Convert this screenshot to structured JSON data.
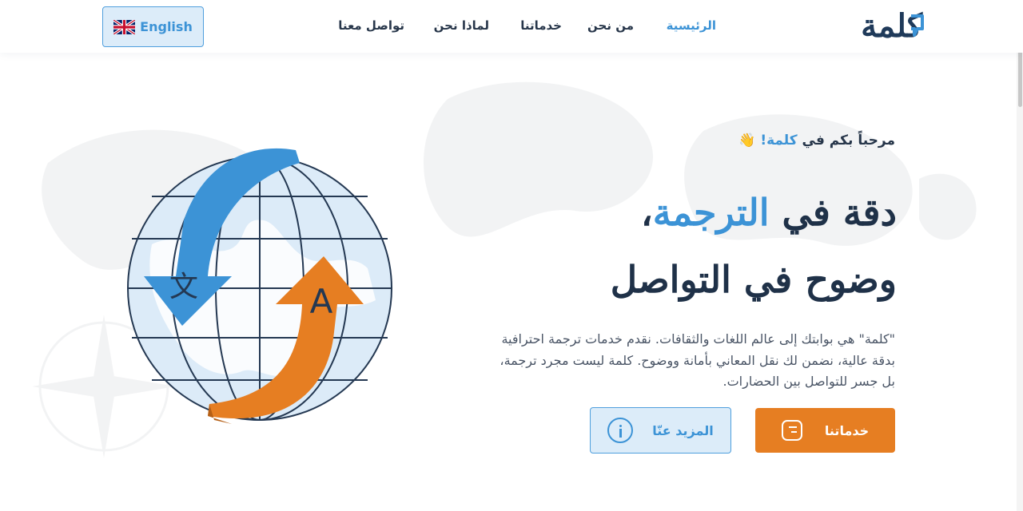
{
  "header": {
    "logo_text": "كلمة",
    "nav": [
      {
        "label": "الرئيسية",
        "active": true
      },
      {
        "label": "من نحن",
        "active": false
      },
      {
        "label": "خدماتنا",
        "active": false
      },
      {
        "label": "لماذا نحن",
        "active": false
      },
      {
        "label": "تواصل معنا",
        "active": false
      }
    ],
    "language_button": {
      "label": "English",
      "flag_icon": "uk-flag-icon"
    }
  },
  "hero": {
    "welcome_prefix": "مرحباً بكم في",
    "welcome_brand": "كلمة!",
    "welcome_icon": "👋",
    "headline_line1_part1": "دقة في",
    "headline_line1_accent": "الترجمة",
    "headline_line1_part2": "،",
    "headline_line2": "وضوح في التواصل",
    "description": "\"كلمة\" هي بوابتك إلى عالم اللغات والثقافات. نقدم خدمات ترجمة احترافية بدقة عالية، نضمن لك نقل المعاني بأمانة ووضوح. كلمة ليست مجرد ترجمة، بل جسر للتواصل بين الحضارات.",
    "primary_button": {
      "label": "خدماتنا",
      "icon": "list-icon"
    },
    "secondary_button": {
      "label": "المزيد عنّا",
      "icon": "info-icon"
    }
  },
  "illustration": {
    "glyph_source": "文",
    "glyph_target": "A"
  },
  "colors": {
    "accent_blue": "#3c93d6",
    "accent_orange": "#e67e22",
    "dark_navy": "#1f3148"
  }
}
